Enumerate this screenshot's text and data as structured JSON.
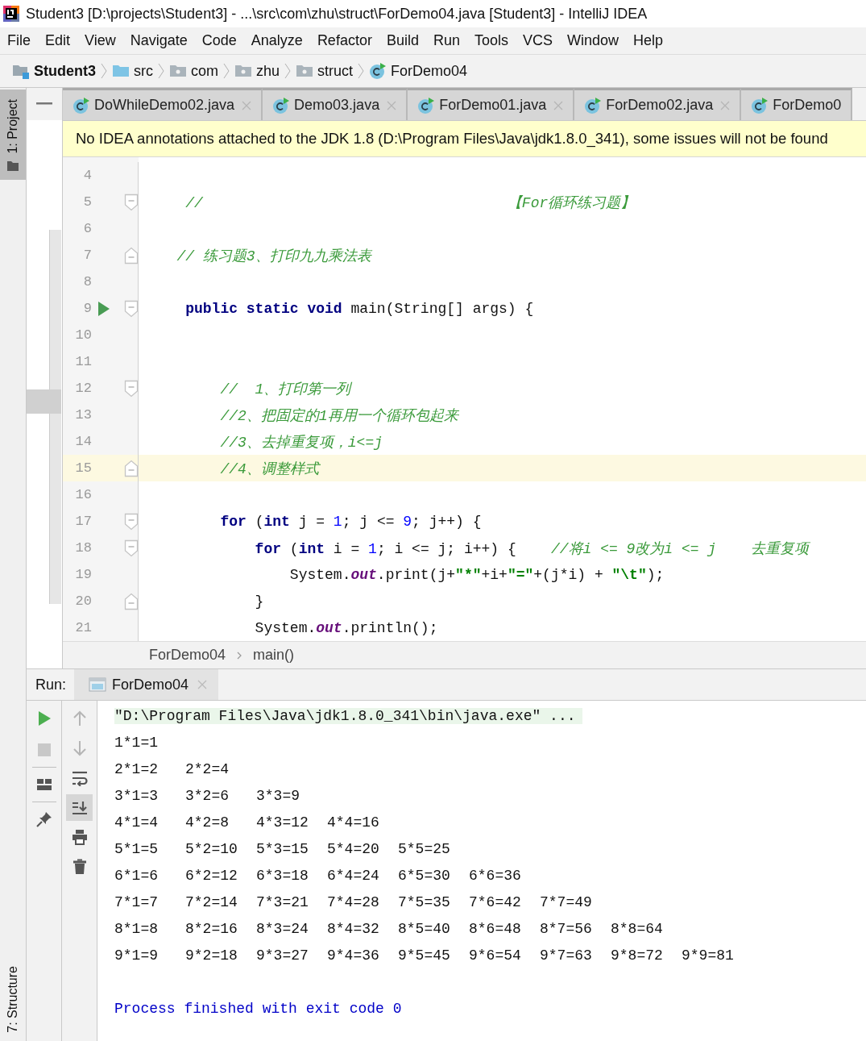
{
  "window": {
    "title": "Student3 [D:\\projects\\Student3] - ...\\src\\com\\zhu\\struct\\ForDemo04.java [Student3] - IntelliJ IDEA"
  },
  "menu": [
    "File",
    "Edit",
    "View",
    "Navigate",
    "Code",
    "Analyze",
    "Refactor",
    "Build",
    "Run",
    "Tools",
    "VCS",
    "Window",
    "Help"
  ],
  "nav_bar": [
    {
      "kind": "project",
      "label": "Student3"
    },
    {
      "kind": "folder",
      "label": "src"
    },
    {
      "kind": "package",
      "label": "com"
    },
    {
      "kind": "package",
      "label": "zhu"
    },
    {
      "kind": "package",
      "label": "struct"
    },
    {
      "kind": "class",
      "label": "ForDemo04"
    }
  ],
  "tool_windows": {
    "top": "1: Project",
    "bottom": "7: Structure"
  },
  "editor_tabs": [
    {
      "label": "DoWhileDemo02.java",
      "selected": false,
      "closable": true
    },
    {
      "label": "Demo03.java",
      "selected": false,
      "closable": true
    },
    {
      "label": "ForDemo01.java",
      "selected": false,
      "closable": true
    },
    {
      "label": "ForDemo02.java",
      "selected": false,
      "closable": true
    },
    {
      "label": "ForDemo0",
      "selected": false,
      "closable": false
    }
  ],
  "banner": "No IDEA annotations attached to the JDK 1.8 (D:\\Program Files\\Java\\jdk1.8.0_341), some issues will not be found",
  "code_lines": [
    {
      "number": "4",
      "current": false,
      "run_marker": false,
      "fold_open": false,
      "fold_close": false
    },
    {
      "number": "5",
      "current": false,
      "run_marker": false,
      "fold_open": true,
      "fold_close": false,
      "tokens": [
        {
          "kind": "comment",
          "text": "    //                                   【For循环练习题】"
        }
      ]
    },
    {
      "number": "6",
      "current": false,
      "run_marker": false,
      "fold_open": false,
      "fold_close": false
    },
    {
      "number": "7",
      "current": false,
      "run_marker": false,
      "fold_open": false,
      "fold_close": true,
      "tokens": [
        {
          "kind": "comment",
          "text": "   // 练习题3、打印九九乘法表"
        }
      ]
    },
    {
      "number": "8",
      "current": false,
      "run_marker": false,
      "fold_open": false,
      "fold_close": false
    },
    {
      "number": "9",
      "current": false,
      "run_marker": true,
      "fold_open": true,
      "fold_close": false,
      "tokens": [
        {
          "kind": "keyword",
          "text": "    public static void"
        },
        {
          "kind": "plain",
          "text": " main(String[] args) {"
        }
      ]
    },
    {
      "number": "10",
      "current": false,
      "run_marker": false,
      "fold_open": false,
      "fold_close": false
    },
    {
      "number": "11",
      "current": false,
      "run_marker": false,
      "fold_open": false,
      "fold_close": false
    },
    {
      "number": "12",
      "current": false,
      "run_marker": false,
      "fold_open": true,
      "fold_close": false,
      "tokens": [
        {
          "kind": "comment",
          "text": "        //  1、打印第一列"
        }
      ]
    },
    {
      "number": "13",
      "current": false,
      "run_marker": false,
      "fold_open": false,
      "fold_close": false,
      "tokens": [
        {
          "kind": "comment",
          "text": "        //2、把固定的1再用一个循环包起来"
        }
      ]
    },
    {
      "number": "14",
      "current": false,
      "run_marker": false,
      "fold_open": false,
      "fold_close": false,
      "tokens": [
        {
          "kind": "comment",
          "text": "        //3、去掉重复项，i<=j"
        }
      ]
    },
    {
      "number": "15",
      "current": true,
      "run_marker": false,
      "fold_open": false,
      "fold_close": true,
      "tokens": [
        {
          "kind": "comment",
          "text": "        //4、调整样式"
        }
      ]
    },
    {
      "number": "16",
      "current": false,
      "run_marker": false,
      "fold_open": false,
      "fold_close": false
    },
    {
      "number": "17",
      "current": false,
      "run_marker": false,
      "fold_open": true,
      "fold_close": false,
      "tokens": [
        {
          "kind": "keyword",
          "text": "        for"
        },
        {
          "kind": "plain",
          "text": " ("
        },
        {
          "kind": "keyword",
          "text": "int"
        },
        {
          "kind": "plain",
          "text": " j = "
        },
        {
          "kind": "number",
          "text": "1"
        },
        {
          "kind": "plain",
          "text": "; j <= "
        },
        {
          "kind": "number",
          "text": "9"
        },
        {
          "kind": "plain",
          "text": "; j++) {"
        }
      ]
    },
    {
      "number": "18",
      "current": false,
      "run_marker": false,
      "fold_open": true,
      "fold_close": false,
      "tokens": [
        {
          "kind": "keyword",
          "text": "            for"
        },
        {
          "kind": "plain",
          "text": " ("
        },
        {
          "kind": "keyword",
          "text": "int"
        },
        {
          "kind": "plain",
          "text": " i = "
        },
        {
          "kind": "number",
          "text": "1"
        },
        {
          "kind": "plain",
          "text": "; i <= j; i++) {    "
        },
        {
          "kind": "comment",
          "text": "//将i <= 9改为i <= j    去重复项"
        }
      ]
    },
    {
      "number": "19",
      "current": false,
      "run_marker": false,
      "fold_open": false,
      "fold_close": false,
      "tokens": [
        {
          "kind": "plain",
          "text": "                System."
        },
        {
          "kind": "field",
          "text": "out"
        },
        {
          "kind": "plain",
          "text": ".print(j+"
        },
        {
          "kind": "string",
          "text": "\"*\""
        },
        {
          "kind": "plain",
          "text": "+i+"
        },
        {
          "kind": "string",
          "text": "\"=\""
        },
        {
          "kind": "plain",
          "text": "+(j*i) + "
        },
        {
          "kind": "string",
          "text": "\"\\t\""
        },
        {
          "kind": "plain",
          "text": ");"
        }
      ]
    },
    {
      "number": "20",
      "current": false,
      "run_marker": false,
      "fold_open": false,
      "fold_close": true,
      "tokens": [
        {
          "kind": "plain",
          "text": "            }"
        }
      ]
    },
    {
      "number": "21",
      "current": false,
      "run_marker": false,
      "fold_open": false,
      "fold_close": false,
      "tokens": [
        {
          "kind": "plain",
          "text": "            System."
        },
        {
          "kind": "field",
          "text": "out"
        },
        {
          "kind": "plain",
          "text": ".println();"
        }
      ]
    }
  ],
  "editor_breadcrumbs": [
    "ForDemo04",
    "main()"
  ],
  "run_panel": {
    "label": "Run:",
    "tab": "ForDemo04",
    "scroll_to_end_on": true,
    "command": "\"D:\\Program Files\\Java\\jdk1.8.0_341\\bin\\java.exe\" ...",
    "output": [
      [
        "1*1=1"
      ],
      [
        "2*1=2",
        "2*2=4"
      ],
      [
        "3*1=3",
        "3*2=6",
        "3*3=9"
      ],
      [
        "4*1=4",
        "4*2=8",
        "4*3=12",
        "4*4=16"
      ],
      [
        "5*1=5",
        "5*2=10",
        "5*3=15",
        "5*4=20",
        "5*5=25"
      ],
      [
        "6*1=6",
        "6*2=12",
        "6*3=18",
        "6*4=24",
        "6*5=30",
        "6*6=36"
      ],
      [
        "7*1=7",
        "7*2=14",
        "7*3=21",
        "7*4=28",
        "7*5=35",
        "7*6=42",
        "7*7=49"
      ],
      [
        "8*1=8",
        "8*2=16",
        "8*3=24",
        "8*4=32",
        "8*5=40",
        "8*6=48",
        "8*7=56",
        "8*8=64"
      ],
      [
        "9*1=9",
        "9*2=18",
        "9*3=27",
        "9*4=36",
        "9*5=45",
        "9*6=54",
        "9*7=63",
        "9*8=72",
        "9*9=81"
      ]
    ],
    "exit_message": "Process finished with exit code 0"
  }
}
